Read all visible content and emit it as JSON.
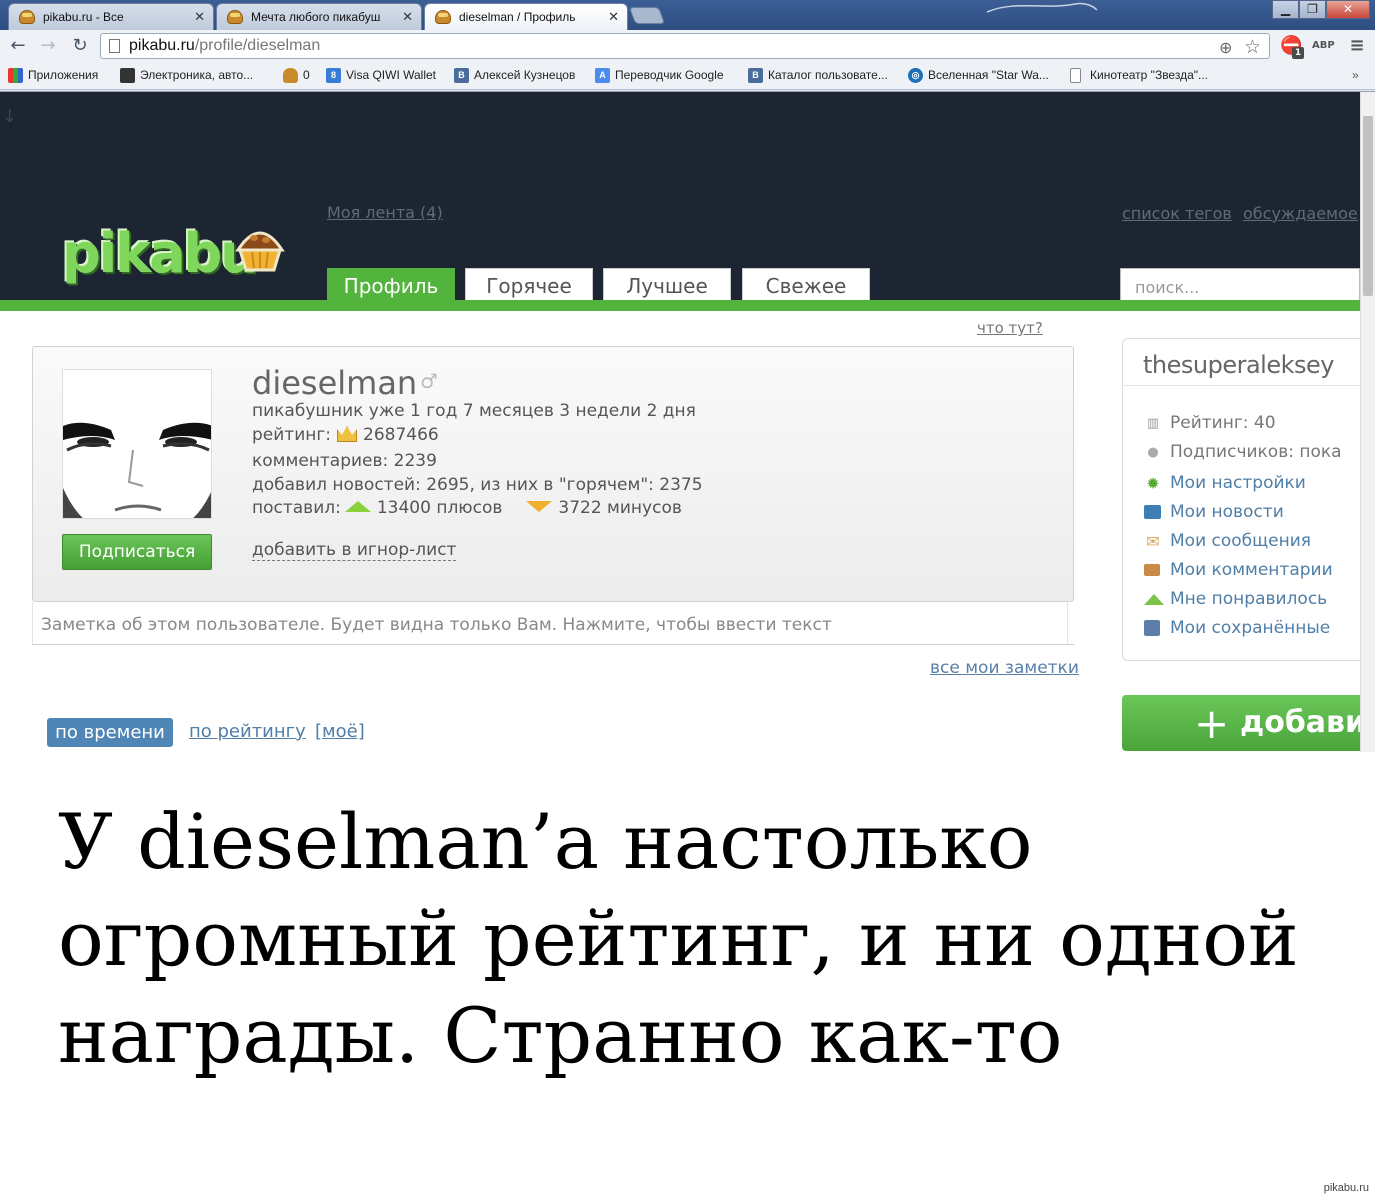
{
  "browser": {
    "tabs": [
      {
        "title": "pikabu.ru - Все"
      },
      {
        "title": "Мечта любого пикабуш"
      },
      {
        "title": "dieselman / Профиль"
      }
    ],
    "address": {
      "host": "pikabu.ru",
      "path": "/profile/dieselman"
    },
    "extensions": {
      "abp": "ABP",
      "badge": "1"
    },
    "bookmarks": [
      {
        "label": "Приложения",
        "icon": "apps-grid-icon"
      },
      {
        "label": "Электроника, авто...",
        "icon": "shop-icon"
      },
      {
        "label": "0",
        "icon": "pikabu-icon"
      },
      {
        "label": "Visa QIWI Wallet",
        "icon": "qiwi-icon"
      },
      {
        "label": "Алексей Кузнецов",
        "icon": "vk-icon"
      },
      {
        "label": "Переводчик Google",
        "icon": "translate-icon"
      },
      {
        "label": "Каталог пользовате...",
        "icon": "vk-icon"
      },
      {
        "label": "Вселенная \"Star Wa...",
        "icon": "globe-icon"
      },
      {
        "label": "Кинотеатр \"Звезда\"...",
        "icon": "page-icon"
      }
    ],
    "bookmarks_more": "»"
  },
  "site": {
    "logo": "pikabu",
    "my_feed": "Моя лента (4)",
    "tag_list": "список тегов",
    "discussed": "обсуждаемое",
    "tabs": [
      "Профиль",
      "Горячее",
      "Лучшее",
      "Свежее"
    ],
    "active_tab": "Профиль",
    "search_placeholder": "поиск..."
  },
  "profile": {
    "what_here": "что тут?",
    "username": "dieselman",
    "member_since": "пикабушник уже 1 год 7 месяцев 3 недели 2 дня",
    "rating_label": "рейтинг:",
    "rating_value": "2687466",
    "comments": "комментариев: 2239",
    "posts": "добавил новостей: 2695, из них в \"горячем\": 2375",
    "votes_label": "поставил:",
    "pluses": "13400 плюсов",
    "minuses": "3722 минусов",
    "subscribe_button": "Подписаться",
    "ignore_link": "добавить в игнор-лист",
    "note_placeholder": "Заметка об этом пользователе. Будет видна только Вам. Нажмите, чтобы ввести текст",
    "all_notes": "все мои заметки"
  },
  "sorting": {
    "by_time": "по времени",
    "by_rating": "по рейтингу",
    "mine": "[моё]"
  },
  "userbox": {
    "name": "thesuperaleksey",
    "rating": "Рейтинг: 40",
    "subscribers": "Подписчиков: пока",
    "links": [
      {
        "label": "Мои настройки",
        "icon": "gear-icon"
      },
      {
        "label": "Мои новости",
        "icon": "news-icon"
      },
      {
        "label": "Мои сообщения",
        "icon": "envelope-icon"
      },
      {
        "label": "Мои комментарии",
        "icon": "comment-icon"
      },
      {
        "label": "Мне понравилось",
        "icon": "thumb-up-icon"
      },
      {
        "label": "Мои сохранённые",
        "icon": "floppy-icon"
      }
    ],
    "add_button": "добавить"
  },
  "caption": {
    "line1": "У dieselman’а настолько",
    "line2": "огромный рейтинг, и ни одной",
    "line3": "награды. Странно как-то"
  },
  "watermark": "pikabu.ru",
  "colors": {
    "header_dark": "#1c2531",
    "accent_green": "#52b33d",
    "link_blue": "#4f7ea8"
  }
}
